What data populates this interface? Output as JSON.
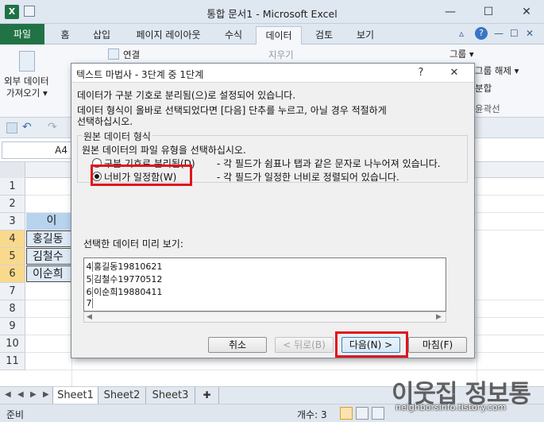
{
  "window": {
    "title": "통합 문서1 - Microsoft Excel",
    "app_icon_letter": "X",
    "minimize": "—",
    "restore": "☐",
    "close": "✕"
  },
  "ribbon_tabs": {
    "file": "파일",
    "items": [
      "홈",
      "삽입",
      "페이지 레이아웃",
      "수식",
      "데이터",
      "검토",
      "보기"
    ],
    "active": "데이터"
  },
  "ribbon": {
    "external_data_line1": "외부 데이터",
    "external_data_line2": "가져오기 ▾",
    "connections": "연결",
    "clear": "지우기",
    "group": "그룹 ▾",
    "ungroup": "그룹 해제 ▾",
    "subtotal": "분합",
    "outline": "윤곽선"
  },
  "formula_bar": {
    "name_box": "A4"
  },
  "sheet": {
    "rows": [
      "1",
      "2",
      "3",
      "4",
      "5",
      "6",
      "7",
      "8",
      "9",
      "10",
      "11"
    ],
    "selected_rows": [
      "4",
      "5",
      "6"
    ],
    "header_cell": "이",
    "data_cells": [
      "홍길동",
      "김철수",
      "이순희"
    ]
  },
  "sheet_tabs": {
    "nav_first": "◀",
    "nav_prev": "◀",
    "nav_next": "▶",
    "nav_last": "▶",
    "tabs": [
      "Sheet1",
      "Sheet2",
      "Sheet3"
    ],
    "active": "Sheet1"
  },
  "status_bar": {
    "ready": "준비",
    "count": "개수: 3"
  },
  "dialog": {
    "title": "텍스트 마법사 - 3단계 중 1단계",
    "help": "?",
    "close": "✕",
    "line1": "데이터가 구분 기호로 분리됨(으)로 설정되어 있습니다.",
    "line2": "데이터 형식이 올바로 선택되었다면 [다음] 단추를 누르고, 아닐 경우 적절하게",
    "line3": "선택하십시오.",
    "group_label": "원본 데이터 형식",
    "group_prompt": "원본 데이터의 파일 유형을 선택하십시오.",
    "option_delimited": "구분 기호로 분리됨(D)",
    "option_delimited_desc": "- 각 필드가 쉼표나 탭과 같은 문자로 나누어져 있습니다.",
    "option_fixed": "너비가 일정함(W)",
    "option_fixed_desc": "- 각 필드가 일정한 너비로 정렬되어 있습니다.",
    "preview_label": "선택한 데이터 미리 보기:",
    "preview_rows": [
      {
        "num": "4",
        "text": "홍길동19810621"
      },
      {
        "num": "5",
        "text": "김철수19770512"
      },
      {
        "num": "6",
        "text": "이순희19880411"
      },
      {
        "num": "7",
        "text": ""
      }
    ],
    "btn_cancel": "취소",
    "btn_back": "< 뒤로(B)",
    "btn_next": "다음(N) >",
    "btn_finish": "마침(F)"
  },
  "watermark": {
    "text": "이웃집 정보통",
    "url": "neighborsinfo.tistory.com"
  },
  "colors": {
    "excel_green": "#217346",
    "highlight_red": "#e0141e",
    "selected_row_header": "#f9d98c",
    "data_cell_fill": "#dde9f6"
  }
}
